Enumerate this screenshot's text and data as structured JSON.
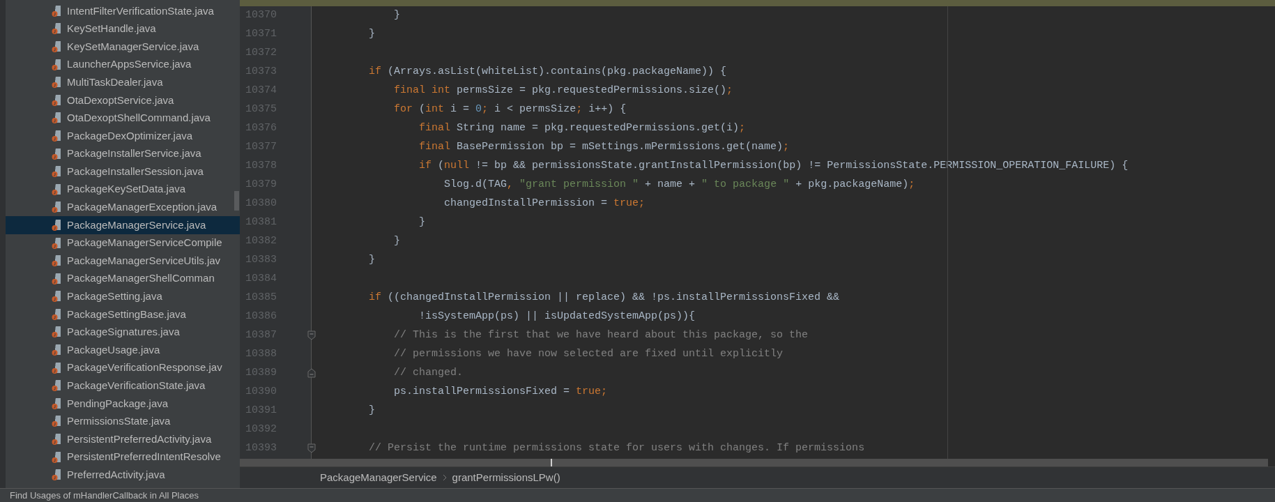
{
  "project_tree": {
    "items": [
      {
        "label": "IntentFilterVerificationState.java",
        "selected": false
      },
      {
        "label": "KeySetHandle.java",
        "selected": false
      },
      {
        "label": "KeySetManagerService.java",
        "selected": false
      },
      {
        "label": "LauncherAppsService.java",
        "selected": false
      },
      {
        "label": "MultiTaskDealer.java",
        "selected": false
      },
      {
        "label": "OtaDexoptService.java",
        "selected": false
      },
      {
        "label": "OtaDexoptShellCommand.java",
        "selected": false
      },
      {
        "label": "PackageDexOptimizer.java",
        "selected": false
      },
      {
        "label": "PackageInstallerService.java",
        "selected": false
      },
      {
        "label": "PackageInstallerSession.java",
        "selected": false
      },
      {
        "label": "PackageKeySetData.java",
        "selected": false
      },
      {
        "label": "PackageManagerException.java",
        "selected": false
      },
      {
        "label": "PackageManagerService.java",
        "selected": true
      },
      {
        "label": "PackageManagerServiceCompile",
        "selected": false
      },
      {
        "label": "PackageManagerServiceUtils.jav",
        "selected": false
      },
      {
        "label": "PackageManagerShellComman",
        "selected": false
      },
      {
        "label": "PackageSetting.java",
        "selected": false
      },
      {
        "label": "PackageSettingBase.java",
        "selected": false
      },
      {
        "label": "PackageSignatures.java",
        "selected": false
      },
      {
        "label": "PackageUsage.java",
        "selected": false
      },
      {
        "label": "PackageVerificationResponse.jav",
        "selected": false
      },
      {
        "label": "PackageVerificationState.java",
        "selected": false
      },
      {
        "label": "PendingPackage.java",
        "selected": false
      },
      {
        "label": "PermissionsState.java",
        "selected": false
      },
      {
        "label": "PersistentPreferredActivity.java",
        "selected": false
      },
      {
        "label": "PersistentPreferredIntentResolve",
        "selected": false
      },
      {
        "label": "PreferredActivity.java",
        "selected": false
      }
    ]
  },
  "editor": {
    "lines": [
      {
        "number": "10370",
        "kind": "plain",
        "tokens": [
          {
            "kind": "plain",
            "text": "            }"
          }
        ]
      },
      {
        "number": "10371",
        "kind": "plain",
        "tokens": [
          {
            "kind": "plain",
            "text": "        }"
          }
        ]
      },
      {
        "number": "10372",
        "kind": "plain"
      },
      {
        "number": "10373",
        "kind": "plain",
        "tokens": [
          {
            "kind": "keyword",
            "text": "        if"
          },
          {
            "kind": "plain",
            "text": " (Arrays.asList(whiteList).contains(pkg.packageName)) {"
          }
        ]
      },
      {
        "number": "10374",
        "kind": "plain",
        "tokens": [
          {
            "kind": "keyword",
            "text": "            final int"
          },
          {
            "kind": "plain",
            "text": " permsSize = pkg.requestedPermissions.size()"
          },
          {
            "kind": "keyword",
            "text": ";"
          }
        ]
      },
      {
        "number": "10375",
        "kind": "plain",
        "tokens": [
          {
            "kind": "keyword",
            "text": "            for"
          },
          {
            "kind": "plain",
            "text": " ("
          },
          {
            "kind": "keyword",
            "text": "int"
          },
          {
            "kind": "plain",
            "text": " i = "
          },
          {
            "kind": "number",
            "text": "0"
          },
          {
            "kind": "keyword",
            "text": ";"
          },
          {
            "kind": "plain",
            "text": " i < permsSize"
          },
          {
            "kind": "keyword",
            "text": ";"
          },
          {
            "kind": "plain",
            "text": " i++) {"
          }
        ]
      },
      {
        "number": "10376",
        "kind": "plain",
        "tokens": [
          {
            "kind": "keyword",
            "text": "                final"
          },
          {
            "kind": "plain",
            "text": " String name = pkg.requestedPermissions.get(i)"
          },
          {
            "kind": "keyword",
            "text": ";"
          }
        ]
      },
      {
        "number": "10377",
        "kind": "plain",
        "tokens": [
          {
            "kind": "keyword",
            "text": "                final"
          },
          {
            "kind": "plain",
            "text": " BasePermission bp = mSettings.mPermissions.get(name)"
          },
          {
            "kind": "keyword",
            "text": ";"
          }
        ]
      },
      {
        "number": "10378",
        "kind": "plain",
        "tokens": [
          {
            "kind": "keyword",
            "text": "                if"
          },
          {
            "kind": "plain",
            "text": " ("
          },
          {
            "kind": "keyword",
            "text": "null"
          },
          {
            "kind": "plain",
            "text": " != bp && permissionsState.grantInstallPermission(bp) != PermissionsState.PERMISSION_OPERATION_FAILURE) {"
          }
        ]
      },
      {
        "number": "10379",
        "kind": "plain",
        "tokens": [
          {
            "kind": "plain",
            "text": "                    Slog.d(TAG"
          },
          {
            "kind": "keyword",
            "text": ", "
          },
          {
            "kind": "string",
            "text": "\"grant permission \""
          },
          {
            "kind": "plain",
            "text": " + name + "
          },
          {
            "kind": "string",
            "text": "\" to package \""
          },
          {
            "kind": "plain",
            "text": " + pkg.packageName)"
          },
          {
            "kind": "keyword",
            "text": ";"
          }
        ]
      },
      {
        "number": "10380",
        "kind": "plain",
        "tokens": [
          {
            "kind": "plain",
            "text": "                    changedInstallPermission = "
          },
          {
            "kind": "keyword",
            "text": "true;"
          }
        ]
      },
      {
        "number": "10381",
        "kind": "plain",
        "tokens": [
          {
            "kind": "plain",
            "text": "                }"
          }
        ]
      },
      {
        "number": "10382",
        "kind": "plain",
        "tokens": [
          {
            "kind": "plain",
            "text": "            }"
          }
        ]
      },
      {
        "number": "10383",
        "kind": "plain",
        "tokens": [
          {
            "kind": "plain",
            "text": "        }"
          }
        ]
      },
      {
        "number": "10384",
        "kind": "plain"
      },
      {
        "number": "10385",
        "kind": "plain",
        "tokens": [
          {
            "kind": "keyword",
            "text": "        if"
          },
          {
            "kind": "plain",
            "text": " ((changedInstallPermission || replace) && !ps.installPermissionsFixed &&"
          }
        ]
      },
      {
        "number": "10386",
        "kind": "plain",
        "tokens": [
          {
            "kind": "plain",
            "text": "                !isSystemApp(ps) || isUpdatedSystemApp(ps)){"
          }
        ]
      },
      {
        "number": "10387",
        "kind": "fold_start",
        "tokens": [
          {
            "kind": "comment",
            "text": "            // This is the first that we have heard about this package, so the"
          }
        ]
      },
      {
        "number": "10388",
        "kind": "plain",
        "tokens": [
          {
            "kind": "comment",
            "text": "            // permissions we have now selected are fixed until explicitly"
          }
        ]
      },
      {
        "number": "10389",
        "kind": "fold_end",
        "tokens": [
          {
            "kind": "comment",
            "text": "            // changed."
          }
        ]
      },
      {
        "number": "10390",
        "kind": "plain",
        "tokens": [
          {
            "kind": "plain",
            "text": "            ps.installPermissionsFixed = "
          },
          {
            "kind": "keyword",
            "text": "true;"
          }
        ]
      },
      {
        "number": "10391",
        "kind": "plain",
        "tokens": [
          {
            "kind": "plain",
            "text": "        }"
          }
        ]
      },
      {
        "number": "10392",
        "kind": "plain"
      },
      {
        "number": "10393",
        "kind": "fold_start",
        "tokens": [
          {
            "kind": "comment",
            "text": "        // Persist the runtime permissions state for users with changes. If permissions"
          }
        ]
      }
    ]
  },
  "breadcrumbs": [
    "PackageManagerService",
    "grantPermissionsLPw()"
  ],
  "status_bar": {
    "message": "Find Usages of mHandlerCallback in All Places"
  }
}
